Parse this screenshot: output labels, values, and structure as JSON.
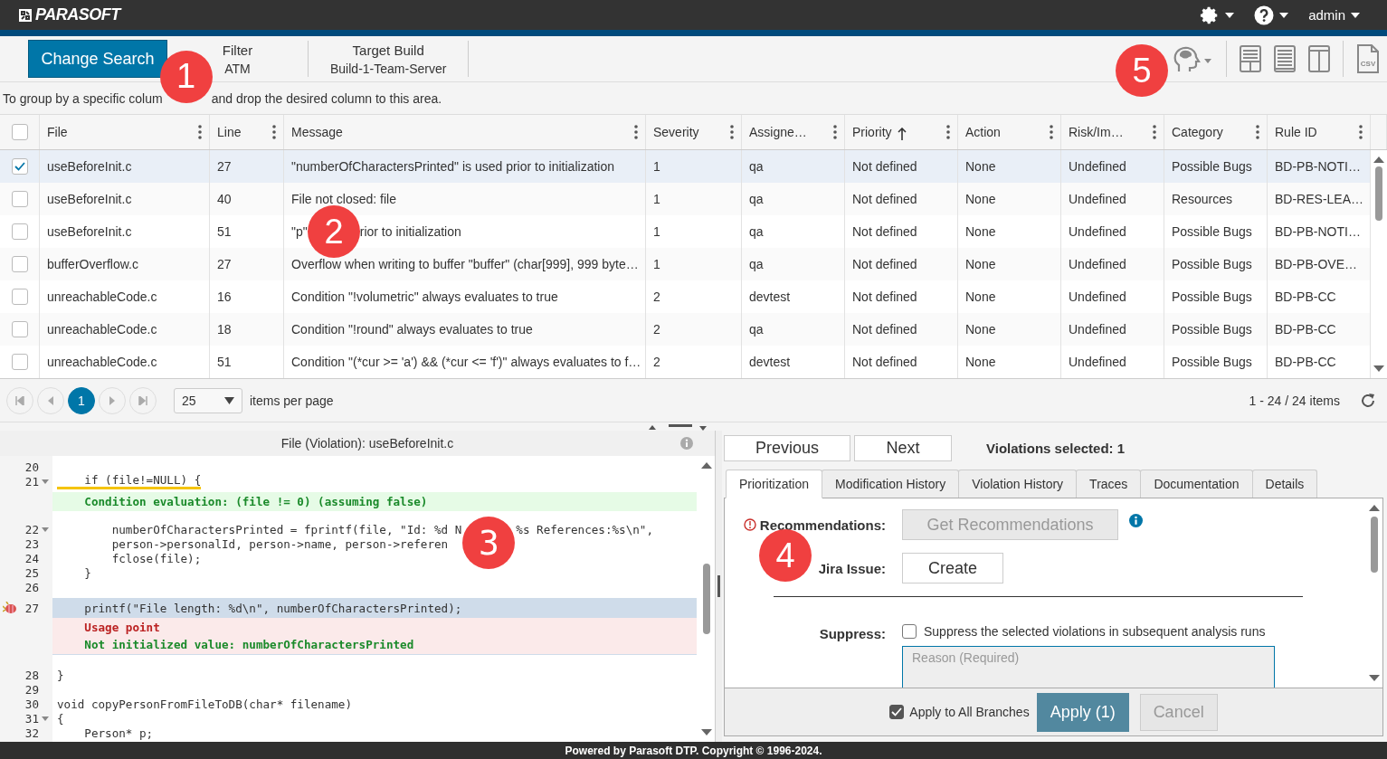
{
  "header": {
    "logo": "PARASOFT",
    "user": "admin"
  },
  "toolbar": {
    "change_search": "Change Search",
    "filters": [
      {
        "label": "Filter",
        "value": "ATM"
      },
      {
        "label": "Target Build",
        "value": "Build-1-Team-Server"
      }
    ],
    "export_label": "CSV",
    "callout": "5"
  },
  "group_hint": {
    "parts": [
      "To group by a specific colum",
      "and drop the desired column to this area."
    ],
    "callout": "1"
  },
  "table": {
    "select_all_checked": false,
    "columns": [
      {
        "label": "File",
        "kind": "plain"
      },
      {
        "label": "Line",
        "kind": "plain"
      },
      {
        "label": "Message",
        "kind": "plain"
      },
      {
        "label": "Severity",
        "kind": "plain"
      },
      {
        "label": "Assigne…",
        "kind": "plain"
      },
      {
        "label": "Priority",
        "kind": "ascending"
      },
      {
        "label": "Action",
        "kind": "plain"
      },
      {
        "label": "Risk/Im…",
        "kind": "plain"
      },
      {
        "label": "Category",
        "kind": "plain"
      },
      {
        "label": "Rule ID",
        "kind": "plain"
      }
    ],
    "rows": [
      {
        "checked": true,
        "selected": true,
        "cells": [
          "useBeforeInit.c",
          "27",
          "\"numberOfCharactersPrinted\" is used prior to initialization",
          "1",
          "qa",
          "Not defined",
          "None",
          "Undefined",
          "Possible Bugs",
          "BD-PB-NOTI…"
        ]
      },
      {
        "checked": false,
        "selected": false,
        "cells": [
          "useBeforeInit.c",
          "40",
          "File not closed: file",
          "1",
          "qa",
          "Not defined",
          "None",
          "Undefined",
          "Resources",
          "BD-RES-LEA…"
        ]
      },
      {
        "checked": false,
        "selected": false,
        "cells": [
          "useBeforeInit.c",
          "51",
          {
            "parts": [
              "\"p\"",
              "rior to initialization"
            ],
            "callout": "2"
          },
          "1",
          "qa",
          "Not defined",
          "None",
          "Undefined",
          "Possible Bugs",
          "BD-PB-NOTI…"
        ]
      },
      {
        "checked": false,
        "selected": false,
        "cells": [
          "bufferOverflow.c",
          "27",
          "Overflow when writing to buffer \"buffer\" (char[999], 999 byte…",
          "1",
          "qa",
          "Not defined",
          "None",
          "Undefined",
          "Possible Bugs",
          "BD-PB-OVE…"
        ]
      },
      {
        "checked": false,
        "selected": false,
        "cells": [
          "unreachableCode.c",
          "16",
          "Condition \"!volumetric\" always evaluates to true",
          "2",
          "devtest",
          "Not defined",
          "None",
          "Undefined",
          "Possible Bugs",
          "BD-PB-CC"
        ]
      },
      {
        "checked": false,
        "selected": false,
        "cells": [
          "unreachableCode.c",
          "18",
          "Condition \"!round\" always evaluates to true",
          "2",
          "qa",
          "Not defined",
          "None",
          "Undefined",
          "Possible Bugs",
          "BD-PB-CC"
        ]
      },
      {
        "checked": false,
        "selected": false,
        "cells": [
          "unreachableCode.c",
          "51",
          "Condition \"(*cur >= 'a') && (*cur <= 'f')\" always evaluates to f…",
          "2",
          "devtest",
          "Not defined",
          "None",
          "Undefined",
          "Possible Bugs",
          "BD-PB-CC"
        ]
      }
    ]
  },
  "pager": {
    "pages": [
      {
        "label": "1",
        "selected": true
      }
    ],
    "page_size": "25",
    "per_page_label": "items per page",
    "summary": "1 - 24 / 24 items"
  },
  "code": {
    "title": "File (Violation): useBeforeInit.c",
    "lines": [
      {
        "kind": "code",
        "num": "20",
        "foldable": false,
        "marker": false,
        "highlighted": false
      },
      {
        "kind": "code",
        "num": "21",
        "parts": [
          "    if (file!=NULL) {"
        ],
        "foldable": true,
        "marker": false,
        "highlighted": false,
        "underlined": true
      },
      {
        "kind": "condition",
        "text": "    Condition evaluation: (file != 0) (assuming false)"
      },
      {
        "kind": "code",
        "num": "22",
        "parts": [
          "        numberOfCharactersPrinted = fprintf(file, \"Id: %d N",
          "%s References:%s\\n\","
        ],
        "callout": "3",
        "foldable": true,
        "marker": false,
        "highlighted": false,
        "underlined": false
      },
      {
        "kind": "code",
        "num": "23",
        "parts": [
          "        person->personalId, person->name, person->referen"
        ],
        "foldable": false,
        "marker": false,
        "highlighted": false,
        "underlined": false
      },
      {
        "kind": "code",
        "num": "24",
        "parts": [
          "        fclose(file);"
        ],
        "foldable": false,
        "marker": false,
        "highlighted": false,
        "underlined": false
      },
      {
        "kind": "code",
        "num": "25",
        "parts": [
          "    }"
        ],
        "foldable": false,
        "marker": false,
        "highlighted": false,
        "underlined": false
      },
      {
        "kind": "code",
        "num": "26",
        "foldable": false,
        "marker": false,
        "highlighted": false
      },
      {
        "kind": "code",
        "num": "27",
        "parts": [
          "    printf(\"File length: %d\\n\", numberOfCharactersPrinted);"
        ],
        "foldable": false,
        "marker": true,
        "highlighted": true,
        "underlined": false
      },
      {
        "kind": "usage",
        "title": "    Usage point",
        "text": "    Not initialized value: numberOfCharactersPrinted"
      },
      {
        "kind": "code",
        "num": "28",
        "parts": [
          "}"
        ],
        "foldable": false,
        "marker": false,
        "highlighted": false,
        "underlined": false
      },
      {
        "kind": "code",
        "num": "29",
        "foldable": false,
        "marker": false,
        "highlighted": false
      },
      {
        "kind": "code",
        "num": "30",
        "parts": [
          "void copyPersonFromFileToDB(char* filename)"
        ],
        "foldable": false,
        "marker": false,
        "highlighted": false,
        "underlined": false
      },
      {
        "kind": "code",
        "num": "31",
        "parts": [
          "{"
        ],
        "foldable": true,
        "marker": false,
        "highlighted": false,
        "underlined": false
      },
      {
        "kind": "code",
        "num": "32",
        "parts": [
          "    Person* p;"
        ],
        "foldable": false,
        "marker": false,
        "highlighted": false,
        "underlined": false
      }
    ]
  },
  "details": {
    "previous": "Previous",
    "next": "Next",
    "selected_count": "Violations selected: 1",
    "tabs": [
      {
        "label": "Prioritization",
        "selected": true
      },
      {
        "label": "Modification History",
        "selected": false
      },
      {
        "label": "Violation History",
        "selected": false
      },
      {
        "label": "Traces",
        "selected": false
      },
      {
        "label": "Documentation",
        "selected": false
      },
      {
        "label": "Details",
        "selected": false
      }
    ],
    "recommendations": {
      "label": "Recommendations:",
      "button": "Get Recommendations",
      "disabled": true
    },
    "jira": {
      "label": "Jira Issue:",
      "button": "Create"
    },
    "suppress": {
      "label": "Suppress:",
      "checkbox_label": "Suppress the selected violations in subsequent analysis runs",
      "checked": false,
      "reason_placeholder": "Reason (Required)"
    },
    "callout": "4",
    "apply_all": {
      "label": "Apply to All Branches",
      "checked": true
    },
    "apply": "Apply (1)",
    "cancel": "Cancel",
    "cancel_disabled": true
  },
  "footer": "Powered by Parasoft DTP. Copyright © 1996-2024."
}
